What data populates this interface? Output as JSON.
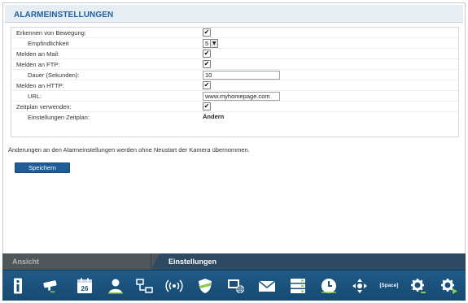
{
  "header": {
    "title": "ALARMEINSTELLUNGEN"
  },
  "settings": {
    "motion_label": "Erkennen von Bewegung:",
    "motion_checked": "✔",
    "sensitivity_label": "Empfindlichkeit",
    "sensitivity_value": "5",
    "mail_label": "Melden an Mail:",
    "mail_checked": "✔",
    "ftp_label": "Melden an FTP:",
    "ftp_checked": "✔",
    "duration_label": "Dauer (Sekunden):",
    "duration_value": "10",
    "http_label": "Melden an HTTP:",
    "http_checked": "✔",
    "url_label": "URL:",
    "url_value": "www.myhomepage.com",
    "schedule_label": "Zeitplan verwenden:",
    "schedule_checked": "✔",
    "schedule_settings_label": "Einstellungen Zeitplan:",
    "schedule_settings_link": "Ändern"
  },
  "info_text": "Änderungen an den Alarmeinstellungen werden ohne Neustart der Kamera übernommen.",
  "save_label": "Speichern",
  "tabs": {
    "view": "Ansicht",
    "settings": "Einstellungen"
  },
  "toolbar": {
    "icons": [
      "info-icon",
      "camera-icon",
      "calendar-icon",
      "user-icon",
      "network-icon",
      "wireless-icon",
      "shield-icon",
      "display-network-icon",
      "mail-icon",
      "server-icon",
      "clock-icon",
      "pan-tilt-icon",
      "space-icon",
      "settings-icon",
      "settings-advanced-icon"
    ],
    "calendar_day": "26",
    "space_label": "[Space]"
  },
  "colors": {
    "accent": "#1e5fa0",
    "toolbar": "#1a527c",
    "tab_active": "#2d4a62",
    "tab_inactive": "#4f5659",
    "icon_green": "#8ccf3f"
  }
}
